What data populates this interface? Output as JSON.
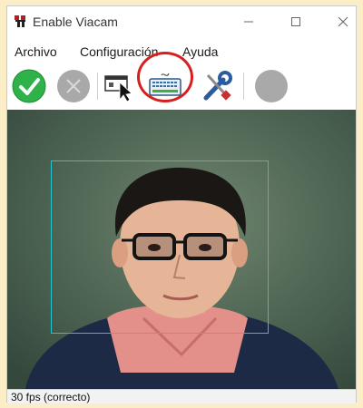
{
  "window": {
    "title": "Enable Viacam"
  },
  "title_buttons": {
    "minimize": "—",
    "maximize": "☐",
    "close": "✕"
  },
  "menu": {
    "items": [
      "Archivo",
      "Configuración",
      "Ayuda"
    ]
  },
  "toolbar": {
    "buttons": [
      {
        "icon": "check-circle-icon",
        "state": "active"
      },
      {
        "icon": "pointer-off-icon",
        "state": "disabled"
      },
      {
        "icon": "click-window-icon"
      },
      {
        "icon": "onscreen-keyboard-icon",
        "highlighted": true
      },
      {
        "icon": "tools-icon"
      },
      {
        "icon": "gray-circle-icon",
        "state": "disabled"
      }
    ]
  },
  "status": {
    "text": "30 fps (correcto)"
  },
  "colors": {
    "accent_green": "#2fb24a",
    "highlight_red": "#d62020",
    "face_box": "#1ec7cf"
  }
}
